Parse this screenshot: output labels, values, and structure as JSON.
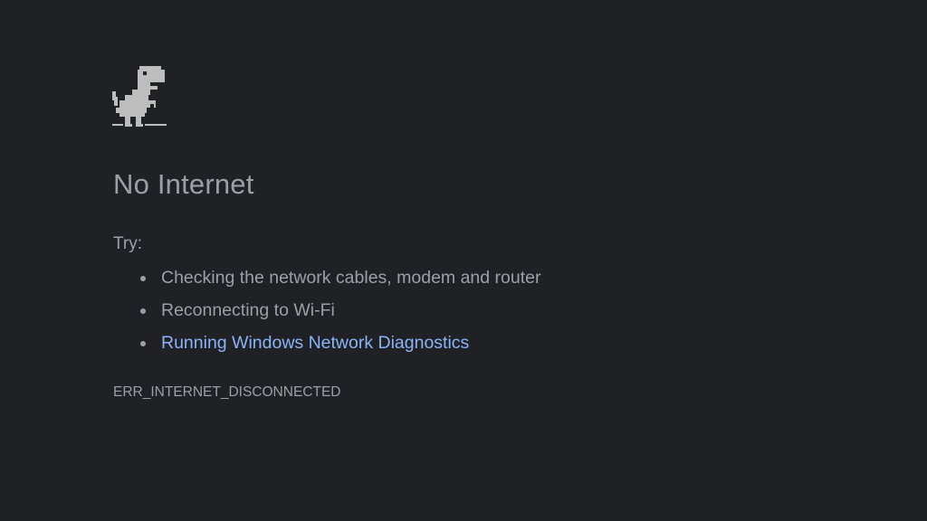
{
  "icon": {
    "name": "offline-dinosaur-icon",
    "color": "#bdbdbd"
  },
  "error": {
    "title": "No Internet",
    "try_label": "Try:",
    "suggestions": [
      "Checking the network cables, modem and router",
      "Reconnecting to Wi-Fi"
    ],
    "link_suggestion": "Running Windows Network Diagnostics",
    "code": "ERR_INTERNET_DISCONNECTED"
  },
  "colors": {
    "background": "#202124",
    "text": "#9aa0a6",
    "link": "#8ab4f8"
  }
}
